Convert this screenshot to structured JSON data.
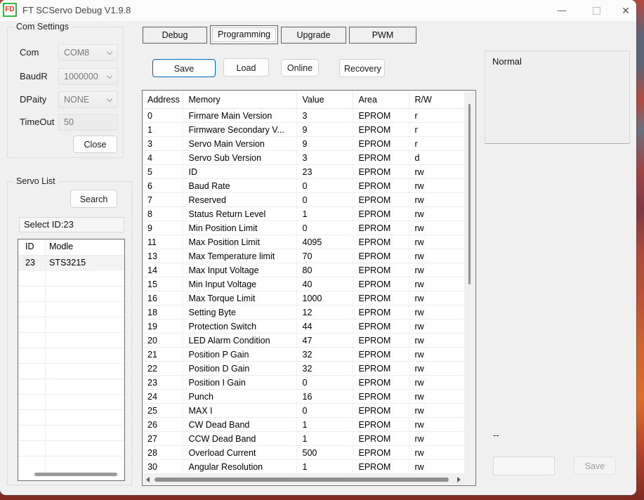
{
  "window": {
    "title": "FT SCServo Debug V1.9.8",
    "icon_text": "FD",
    "controls": {
      "minimize": "—",
      "close": "✕"
    }
  },
  "com_settings": {
    "title": "Com Settings",
    "fields": [
      {
        "label": "Com",
        "value": "COM8"
      },
      {
        "label": "BaudR",
        "value": "1000000"
      },
      {
        "label": "DPaity",
        "value": "NONE"
      },
      {
        "label": "TimeOut",
        "value": "50"
      }
    ],
    "close_label": "Close"
  },
  "servo_list": {
    "title": "Servo List",
    "search_label": "Search",
    "select_id_text": "Select ID:23",
    "columns": {
      "id": "ID",
      "model": "Modle"
    },
    "rows": [
      {
        "id": "23",
        "model": "STS3215"
      }
    ]
  },
  "tabs": [
    {
      "label": "Debug"
    },
    {
      "label": "Programming"
    },
    {
      "label": "Upgrade"
    },
    {
      "label": "PWM"
    }
  ],
  "toolbar": {
    "save": "Save",
    "load": "Load",
    "online": "Online",
    "recovery": "Recovery"
  },
  "memory_table": {
    "columns": {
      "address": "Address",
      "memory": "Memory",
      "value": "Value",
      "area": "Area",
      "rw": "R/W"
    },
    "rows": [
      {
        "address": "0",
        "memory": "Firmare Main Version",
        "value": "3",
        "area": "EPROM",
        "rw": "r"
      },
      {
        "address": "1",
        "memory": "Firmware Secondary V...",
        "value": "9",
        "area": "EPROM",
        "rw": "r"
      },
      {
        "address": "3",
        "memory": "Servo Main Version",
        "value": "9",
        "area": "EPROM",
        "rw": "r"
      },
      {
        "address": "4",
        "memory": "Servo Sub Version",
        "value": "3",
        "area": "EPROM",
        "rw": "d"
      },
      {
        "address": "5",
        "memory": "ID",
        "value": "23",
        "area": "EPROM",
        "rw": "rw"
      },
      {
        "address": "6",
        "memory": "Baud Rate",
        "value": "0",
        "area": "EPROM",
        "rw": "rw"
      },
      {
        "address": "7",
        "memory": "Reserved",
        "value": "0",
        "area": "EPROM",
        "rw": "rw"
      },
      {
        "address": "8",
        "memory": "Status Return Level",
        "value": "1",
        "area": "EPROM",
        "rw": "rw"
      },
      {
        "address": "9",
        "memory": "Min Position Limit",
        "value": "0",
        "area": "EPROM",
        "rw": "rw"
      },
      {
        "address": "11",
        "memory": "Max Position Limit",
        "value": "4095",
        "area": "EPROM",
        "rw": "rw"
      },
      {
        "address": "13",
        "memory": "Max Temperature limit",
        "value": "70",
        "area": "EPROM",
        "rw": "rw"
      },
      {
        "address": "14",
        "memory": "Max Input Voltage",
        "value": "80",
        "area": "EPROM",
        "rw": "rw"
      },
      {
        "address": "15",
        "memory": "Min Input Voltage",
        "value": "40",
        "area": "EPROM",
        "rw": "rw"
      },
      {
        "address": "16",
        "memory": "Max Torque Limit",
        "value": "1000",
        "area": "EPROM",
        "rw": "rw"
      },
      {
        "address": "18",
        "memory": "Setting Byte",
        "value": "12",
        "area": "EPROM",
        "rw": "rw"
      },
      {
        "address": "19",
        "memory": "Protection Switch",
        "value": "44",
        "area": "EPROM",
        "rw": "rw"
      },
      {
        "address": "20",
        "memory": "LED Alarm Condition",
        "value": "47",
        "area": "EPROM",
        "rw": "rw"
      },
      {
        "address": "21",
        "memory": "Position P Gain",
        "value": "32",
        "area": "EPROM",
        "rw": "rw"
      },
      {
        "address": "22",
        "memory": "Position D Gain",
        "value": "32",
        "area": "EPROM",
        "rw": "rw"
      },
      {
        "address": "23",
        "memory": "Position I Gain",
        "value": "0",
        "area": "EPROM",
        "rw": "rw"
      },
      {
        "address": "24",
        "memory": "Punch",
        "value": "16",
        "area": "EPROM",
        "rw": "rw"
      },
      {
        "address": "25",
        "memory": "MAX I",
        "value": "0",
        "area": "EPROM",
        "rw": "rw"
      },
      {
        "address": "26",
        "memory": "CW Dead Band",
        "value": "1",
        "area": "EPROM",
        "rw": "rw"
      },
      {
        "address": "27",
        "memory": "CCW Dead Band",
        "value": "1",
        "area": "EPROM",
        "rw": "rw"
      },
      {
        "address": "28",
        "memory": "Overload Current",
        "value": "500",
        "area": "EPROM",
        "rw": "rw"
      },
      {
        "address": "30",
        "memory": "Angular Resolution",
        "value": "1",
        "area": "EPROM",
        "rw": "rw"
      }
    ]
  },
  "status_panel": {
    "status_text": "Normal",
    "dashes": "--",
    "input_value": "",
    "save_label": "Save"
  },
  "colors": {
    "accent_button_border": "#0067c0",
    "window_bg": "#f0f0f0",
    "titlebar_bg": "#fbfbfb",
    "table_border": "#6e6e6e",
    "icon_green": "#2db93e",
    "icon_red": "#e8311f"
  }
}
